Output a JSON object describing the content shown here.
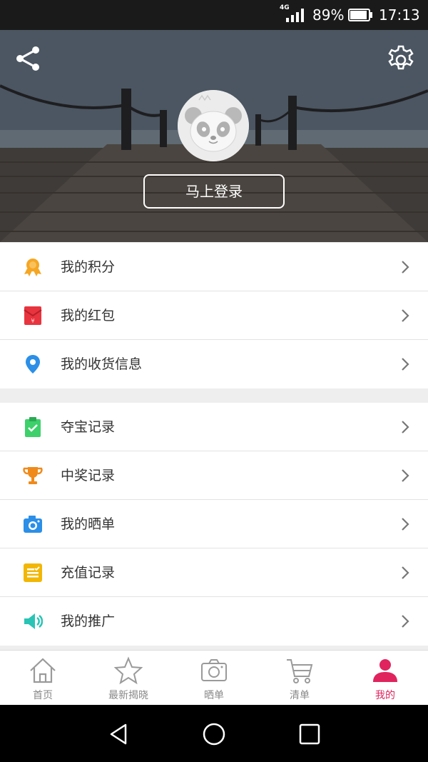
{
  "status_bar": {
    "network": "4G",
    "battery": "89%",
    "time": "17:13"
  },
  "header": {
    "login_label": "马上登录"
  },
  "menu_group_1": [
    {
      "label": "我的积分",
      "icon": "medal-icon"
    },
    {
      "label": "我的红包",
      "icon": "red-envelope-icon"
    },
    {
      "label": "我的收货信息",
      "icon": "location-pin-icon"
    }
  ],
  "menu_group_2": [
    {
      "label": "夺宝记录",
      "icon": "clipboard-check-icon"
    },
    {
      "label": "中奖记录",
      "icon": "trophy-icon"
    },
    {
      "label": "我的晒单",
      "icon": "camera-icon"
    },
    {
      "label": "充值记录",
      "icon": "list-note-icon"
    },
    {
      "label": "我的推广",
      "icon": "speaker-icon"
    }
  ],
  "tabs": [
    {
      "label": "首页",
      "icon": "home-icon"
    },
    {
      "label": "最新揭晓",
      "icon": "star-icon"
    },
    {
      "label": "晒单",
      "icon": "camera-icon"
    },
    {
      "label": "清单",
      "icon": "cart-icon"
    },
    {
      "label": "我的",
      "icon": "user-icon",
      "active": true
    }
  ],
  "colors": {
    "accent": "#e0245e",
    "medal": "#f5a623",
    "red_envelope": "#e8343f",
    "location": "#2b8fe8",
    "clipboard": "#3dd06b",
    "trophy": "#f08a1a",
    "camera": "#2b8fe8",
    "note": "#f2b705",
    "speaker": "#29c4b5"
  }
}
